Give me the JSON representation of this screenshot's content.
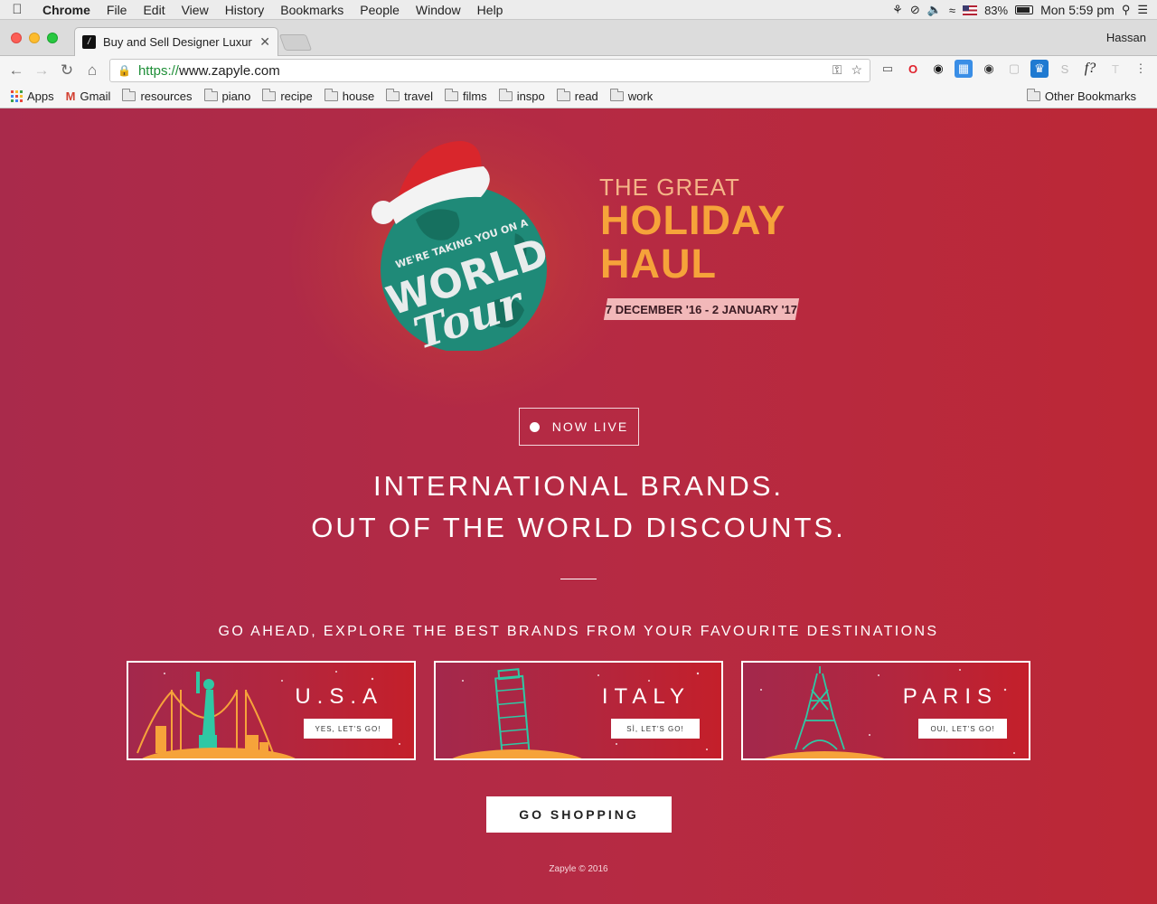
{
  "menubar": {
    "app": "Chrome",
    "items": [
      "File",
      "Edit",
      "View",
      "History",
      "Bookmarks",
      "People",
      "Window",
      "Help"
    ],
    "battery": "83%",
    "clock": "Mon 5:59 pm"
  },
  "browser": {
    "tab_title": "Buy and Sell Designer Luxury",
    "profile": "Hassan",
    "url_scheme": "https://",
    "url_host": "www.zapyle.com"
  },
  "bookmarks": {
    "apps": "Apps",
    "gmail": "Gmail",
    "folders": [
      "resources",
      "piano",
      "recipe",
      "house",
      "travel",
      "films",
      "inspo",
      "read",
      "work"
    ],
    "other": "Other Bookmarks"
  },
  "hero": {
    "logo_arc": "WE'RE TAKING YOU ON A",
    "logo_world": "WORLD",
    "logo_tour": "Tour",
    "kicker": "THE GREAT",
    "title_line1": "HOLIDAY",
    "title_line2": "HAUL",
    "dates": "7 DECEMBER '16 - 2 JANUARY '17"
  },
  "live_badge": "NOW LIVE",
  "headline": {
    "line1": "INTERNATIONAL BRANDS.",
    "line2": "OUT OF THE WORLD DISCOUNTS."
  },
  "explore": "GO AHEAD, EXPLORE THE BEST BRANDS FROM YOUR FAVOURITE DESTINATIONS",
  "destinations": [
    {
      "name": "U.S.A",
      "button": "YES, LET'S GO!"
    },
    {
      "name": "ITALY",
      "button": "SÌ, LET'S GO!"
    },
    {
      "name": "PARIS",
      "button": "OUI, LET'S GO!"
    }
  ],
  "cta": "GO SHOPPING",
  "footer": "Zapyle © 2016",
  "colors": {
    "background": "#b72a3f",
    "accent_orange": "#f6a33a",
    "globe": "#1f8a78",
    "hat_red": "#d9262c"
  }
}
